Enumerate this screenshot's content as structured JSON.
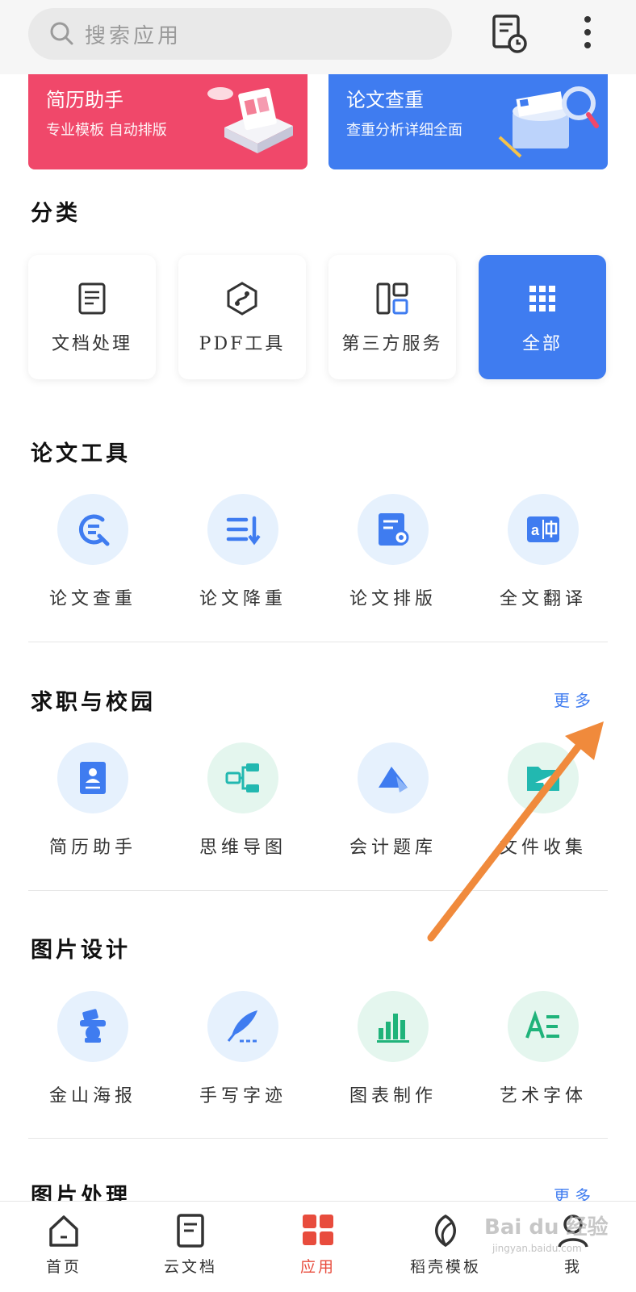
{
  "search": {
    "placeholder": "搜索应用"
  },
  "banners": [
    {
      "title": "简历助手",
      "subtitle": "专业模板 自动排版"
    },
    {
      "title": "论文查重",
      "subtitle": "查重分析详细全面"
    }
  ],
  "category_section": {
    "title": "分类",
    "cards": [
      {
        "label": "文档处理",
        "icon": "document-icon"
      },
      {
        "label": "PDF工具",
        "icon": "pdf-icon"
      },
      {
        "label": "第三方服务",
        "icon": "layout-grid-icon"
      },
      {
        "label": "全部",
        "icon": "all-apps-icon"
      }
    ]
  },
  "paper_tools": {
    "title": "论文工具",
    "items": [
      {
        "label": "论文查重",
        "icon": "paper-check-icon"
      },
      {
        "label": "论文降重",
        "icon": "paper-reduce-icon"
      },
      {
        "label": "论文排版",
        "icon": "paper-format-icon"
      },
      {
        "label": "全文翻译",
        "icon": "translate-icon"
      }
    ]
  },
  "career": {
    "title": "求职与校园",
    "more": "更多",
    "items": [
      {
        "label": "简历助手",
        "icon": "resume-icon"
      },
      {
        "label": "思维导图",
        "icon": "mindmap-icon"
      },
      {
        "label": "会计题库",
        "icon": "accounting-icon"
      },
      {
        "label": "文件收集",
        "icon": "file-collect-icon"
      }
    ]
  },
  "image_design": {
    "title": "图片设计",
    "items": [
      {
        "label": "金山海报",
        "icon": "poster-icon"
      },
      {
        "label": "手写字迹",
        "icon": "handwriting-icon"
      },
      {
        "label": "图表制作",
        "icon": "chart-icon"
      },
      {
        "label": "艺术字体",
        "icon": "art-font-icon"
      }
    ]
  },
  "image_process": {
    "title": "图片处理",
    "more": "更多"
  },
  "bottom_nav": [
    {
      "label": "首页",
      "icon": "home-icon"
    },
    {
      "label": "云文档",
      "icon": "cloud-doc-icon"
    },
    {
      "label": "应用",
      "icon": "apps-icon",
      "active": true
    },
    {
      "label": "稻壳模板",
      "icon": "leaf-icon"
    },
    {
      "label": "我",
      "icon": "user-icon"
    }
  ],
  "watermark": {
    "text": "Bai du 经验",
    "sub": "jingyan.baidu.com"
  },
  "colors": {
    "primary": "#3f7cf0",
    "resume_banner": "#f0486a",
    "nav_active": "#e84c3d",
    "annotation_arrow": "#f08a3c"
  }
}
